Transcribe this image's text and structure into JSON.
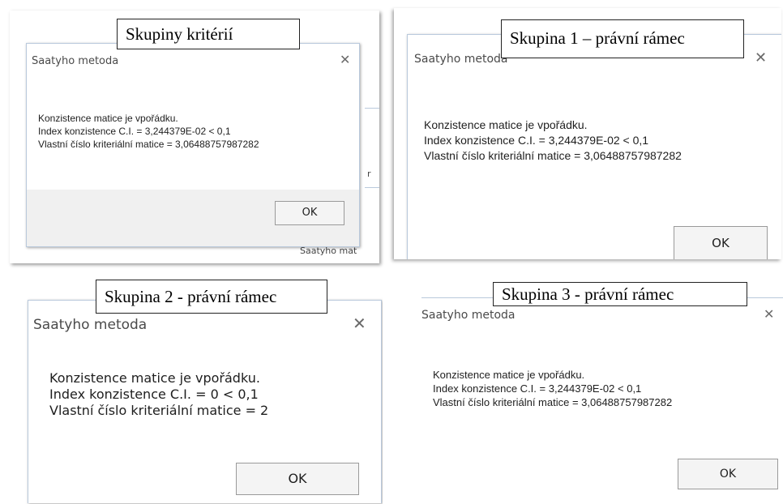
{
  "panels": [
    {
      "caption": "Skupiny kritérií",
      "dialog": {
        "title": "Saatyho metoda",
        "close": "✕",
        "lines": [
          "Konzistence matice je vpořádku.",
          "Index konzistence C.I. = 3,244379E-02 < 0,1",
          "Vlastní číslo kriteriální matice = 3,06488757987282"
        ],
        "ok": "OK"
      },
      "background_fragment": "Saatyho mat",
      "background_fragment2": "r"
    },
    {
      "caption": "Skupina 1 – právní rámec",
      "dialog": {
        "title": "Saatyho metoda",
        "close": "✕",
        "lines": [
          "Konzistence matice je vpořádku.",
          "Index konzistence C.I. = 3,244379E-02 < 0,1",
          "Vlastní číslo kriteriální matice = 3,06488757987282"
        ],
        "ok": "OK"
      }
    },
    {
      "caption": "Skupina 2 - právní rámec",
      "dialog": {
        "title": "Saatyho metoda",
        "close": "✕",
        "lines": [
          "Konzistence matice je vpořádku.",
          "Index konzistence C.I. = 0 < 0,1",
          "Vlastní číslo kriteriální matice = 2"
        ],
        "ok": "OK"
      }
    },
    {
      "caption": "Skupina 3 - právní rámec",
      "dialog": {
        "title": "Saatyho metoda",
        "close": "✕",
        "lines": [
          "Konzistence matice je vpořádku.",
          "Index konzistence C.I. = 3,244379E-02 < 0,1",
          "Vlastní číslo kriteriální matice = 3,06488757987282"
        ],
        "ok": "OK"
      }
    }
  ]
}
